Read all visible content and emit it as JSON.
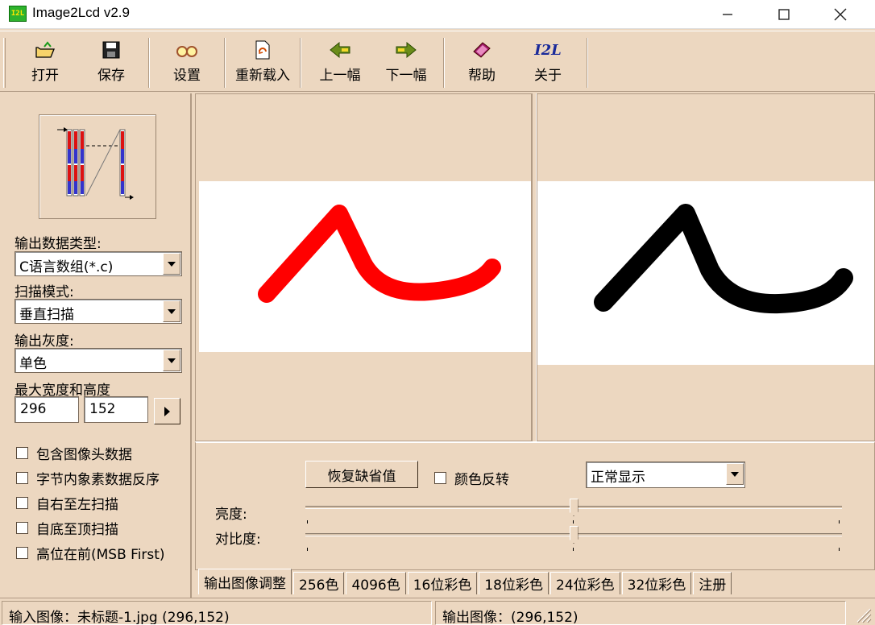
{
  "window": {
    "icon_text": "I2L",
    "title": "Image2Lcd v2.9"
  },
  "toolbar": {
    "open": "打开",
    "save": "保存",
    "settings": "设置",
    "reload": "重新载入",
    "prev": "上一幅",
    "next": "下一幅",
    "help": "帮助",
    "about_icon_text": "I2L",
    "about": "关于"
  },
  "left": {
    "output_type_label": "输出数据类型:",
    "output_type_value": "C语言数组(*.c)",
    "scan_mode_label": "扫描模式:",
    "scan_mode_value": "垂直扫描",
    "gray_label": "输出灰度:",
    "gray_value": "单色",
    "size_label": "最大宽度和高度",
    "width": "296",
    "height": "152",
    "checkboxes": [
      {
        "label": "包含图像头数据",
        "checked": false
      },
      {
        "label": "字节内象素数据反序",
        "checked": false
      },
      {
        "label": "自右至左扫描",
        "checked": false
      },
      {
        "label": "自底至顶扫描",
        "checked": false
      },
      {
        "label": "高位在前(MSB First)",
        "checked": false
      }
    ]
  },
  "adjust": {
    "restore_button": "恢复缺省值",
    "invert_label": "颜色反转",
    "invert_checked": false,
    "display_mode": "正常显示",
    "brightness_label": "亮度:",
    "contrast_label": "对比度:",
    "brightness_level": 0.5,
    "contrast_level": 0.5
  },
  "tabs": [
    "输出图像调整",
    "256色",
    "4096色",
    "16位彩色",
    "18位彩色",
    "24位彩色",
    "32位彩色",
    "注册"
  ],
  "active_tab": 0,
  "status": {
    "input": "输入图像：未标题-1.jpg (296,152)",
    "output": "输出图像：(296,152)"
  },
  "colors": {
    "background": "#ecd7c0",
    "input_stroke": "#ff0000",
    "output_stroke": "#000000",
    "icon_green": "#2db32d"
  }
}
